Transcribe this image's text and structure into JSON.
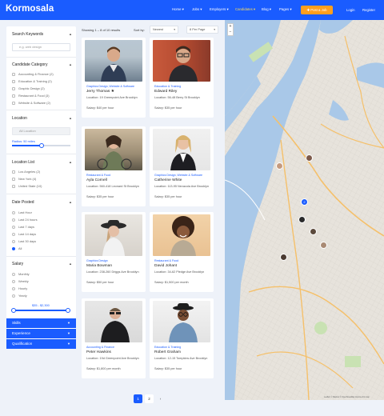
{
  "header": {
    "logo": "Kormosala",
    "nav": [
      "Home ▾",
      "Jobs ▾",
      "Employers ▾",
      "Candidates ▾",
      "Blog ▾",
      "Pages ▾"
    ],
    "post_button": "✚ Post a Job",
    "login": "Login",
    "register": "Register"
  },
  "sidebar": {
    "search_title": "Search Keywords",
    "search_placeholder": "e.g. web design",
    "category_title": "Candidate Category",
    "categories": [
      "Accounting & Finance (2)",
      "Education & Training (2)",
      "Graphic Design (2)",
      "Restaurant & Food (3)",
      "Website & Software (2)"
    ],
    "location_title": "Location",
    "location_placeholder": "All Location",
    "radius_label": "Radius: 50 miles",
    "radius_fraction": 0.5,
    "location_list_title": "Location List",
    "locations": [
      "Los Angeles (2)",
      "New York (4)",
      "United State (10)"
    ],
    "date_title": "Date Posted",
    "dates": [
      "Last Hour",
      "Last 24 hours",
      "Last 7 days",
      "Last 14 days",
      "Last 30 days",
      "All"
    ],
    "salary_title": "Salary",
    "salary_types": [
      "Monthly",
      "Weekly",
      "Hourly",
      "Yearly"
    ],
    "salary_range": "$35 - $2,300",
    "skills": "Skills",
    "experience": "Experience",
    "qualification": "Qualification"
  },
  "toolbar": {
    "showing": "Showing 1 – 8 of 10 results",
    "sort_label": "Sort by:",
    "sort_value": "Newest",
    "per_page": "8 Per Page"
  },
  "candidates": [
    {
      "category": "Graphics Design, Website & Software",
      "name": "Jerry Thomas ★",
      "location": "Location: 19 Greenpoint Ave Brooklyn",
      "salary": "Salary: $40 per hour"
    },
    {
      "category": "Education & Training",
      "name": "Edward Riley",
      "location": "Location: 56-48 Berry St Brooklyn",
      "salary": "Salary: $35 per hour"
    },
    {
      "category": "Restaurant & Food",
      "name": "Ayla Cornell",
      "location": "Location: 560-418 Leonard St Brooklyn",
      "salary": "Salary: $35 per hour"
    },
    {
      "category": "Graphics Design, Website & Software",
      "name": "Catherine White",
      "location": "Location: 113-95 Nevacola Ave Brooklyn",
      "salary": "Salary: $35 per hour"
    },
    {
      "category": "Graphics Design",
      "name": "Maria Bowman",
      "location": "Location: 238-260 Driggs Ave Brooklyn",
      "salary": "Salary: $50 per hour"
    },
    {
      "category": "Restaurant & Food",
      "name": "David Johant",
      "location": "Location: 34-62 Pledge Ave Brooklyn",
      "salary": "Salary: $1,500 per month"
    },
    {
      "category": "Accounting & Finance",
      "name": "Peter Hawkins",
      "location": "Location: 19d Greenpoint Ave Brooklyn",
      "salary": "Salary: $1,800 per month"
    },
    {
      "category": "Education & Training",
      "name": "Robert Graham",
      "location": "Location: 12-15 Tompkins Ave Brooklyn",
      "salary": "Salary: $35 per hour"
    }
  ],
  "pagination": [
    "1",
    "2",
    "›"
  ],
  "map": {
    "zoom_in": "+",
    "zoom_out": "−",
    "cluster": "2",
    "attribution": "Leaflet | © Mapbox © OpenStreetMap Improve this map"
  },
  "colors": {
    "accent": "#1a5cff",
    "orange": "#ff9f1c",
    "water": "#a9c8e8"
  }
}
